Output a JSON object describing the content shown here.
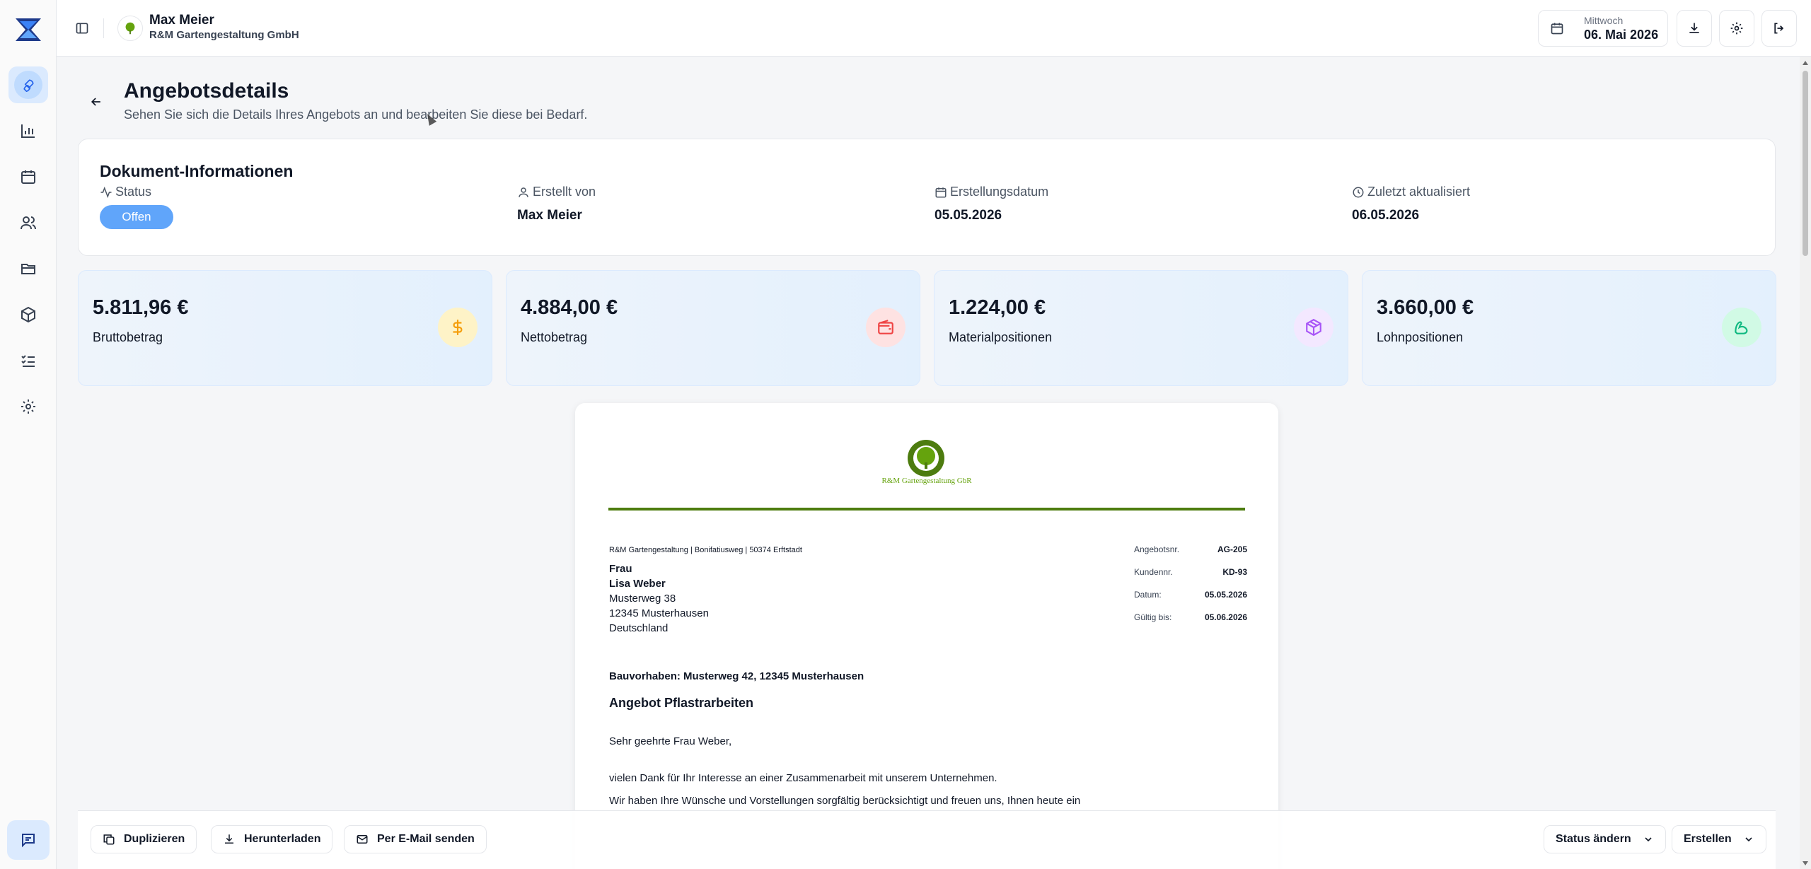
{
  "header": {
    "user_name": "Max Meier",
    "company": "R&M Gartengestaltung GmbH",
    "date_weekday": "Mittwoch",
    "date_value": "06. Mai 2026"
  },
  "sidebar": {
    "items": [
      {
        "icon": "rocket-icon",
        "active": true
      },
      {
        "icon": "chart-icon"
      },
      {
        "icon": "calendar-icon"
      },
      {
        "icon": "users-icon"
      },
      {
        "icon": "folder-icon"
      },
      {
        "icon": "box-icon"
      },
      {
        "icon": "checklist-icon"
      },
      {
        "icon": "gear-icon"
      }
    ]
  },
  "page": {
    "title": "Angebotsdetails",
    "subtitle": "Sehen Sie sich die Details Ihres Angebots an und bearbeiten Sie diese bei Bedarf."
  },
  "info": {
    "title": "Dokument-Informationen",
    "status_label": "Status",
    "status_value": "Offen",
    "created_by_label": "Erstellt von",
    "created_by_value": "Max Meier",
    "created_date_label": "Erstellungsdatum",
    "created_date_value": "05.05.2026",
    "updated_label": "Zuletzt aktualisiert",
    "updated_value": "06.05.2026"
  },
  "stats": [
    {
      "value": "5.811,96 €",
      "label": "Bruttobetrag",
      "icon": "dollar-icon",
      "color": "#f59e0b",
      "bg": "#fef3c7"
    },
    {
      "value": "4.884,00 €",
      "label": "Nettobetrag",
      "icon": "wallet-icon",
      "color": "#ef4444",
      "bg": "#fee2e2"
    },
    {
      "value": "1.224,00 €",
      "label": "Materialpositionen",
      "icon": "package-icon",
      "color": "#a855f7",
      "bg": "#f3e8ff"
    },
    {
      "value": "3.660,00 €",
      "label": "Lohnpositionen",
      "icon": "arm-icon",
      "color": "#10b981",
      "bg": "#d1fae5"
    }
  ],
  "document": {
    "logo_text": "R&M Gartengestaltung GbR",
    "sender_line": "R&M Gartengestaltung | Bonifatiusweg | 50374 Erftstadt",
    "recipient": [
      "Frau",
      "Lisa Weber",
      "Musterweg 38",
      "12345 Musterhausen",
      "Deutschland"
    ],
    "meta": [
      {
        "key": "Angebotsnr.",
        "value": "AG-205"
      },
      {
        "key": "Kundennr.",
        "value": "KD-93"
      },
      {
        "key": "Datum:",
        "value": "05.05.2026"
      },
      {
        "key": "Gültig bis:",
        "value": "05.06.2026"
      }
    ],
    "project": "Bauvorhaben: Musterweg 42, 12345 Musterhausen",
    "heading": "Angebot Pflastrarbeiten",
    "salutation": "Sehr geehrte Frau Weber,",
    "para1": "vielen Dank für Ihr Interesse an einer Zusammenarbeit mit unserem Unternehmen.",
    "para2": "Wir haben Ihre Wünsche und Vorstellungen sorgfältig berücksichtigt und freuen uns, Ihnen heute ein"
  },
  "footer": {
    "duplicate": "Duplizieren",
    "download": "Herunterladen",
    "email": "Per E-Mail senden",
    "status": "Status ändern",
    "create": "Erstellen"
  }
}
